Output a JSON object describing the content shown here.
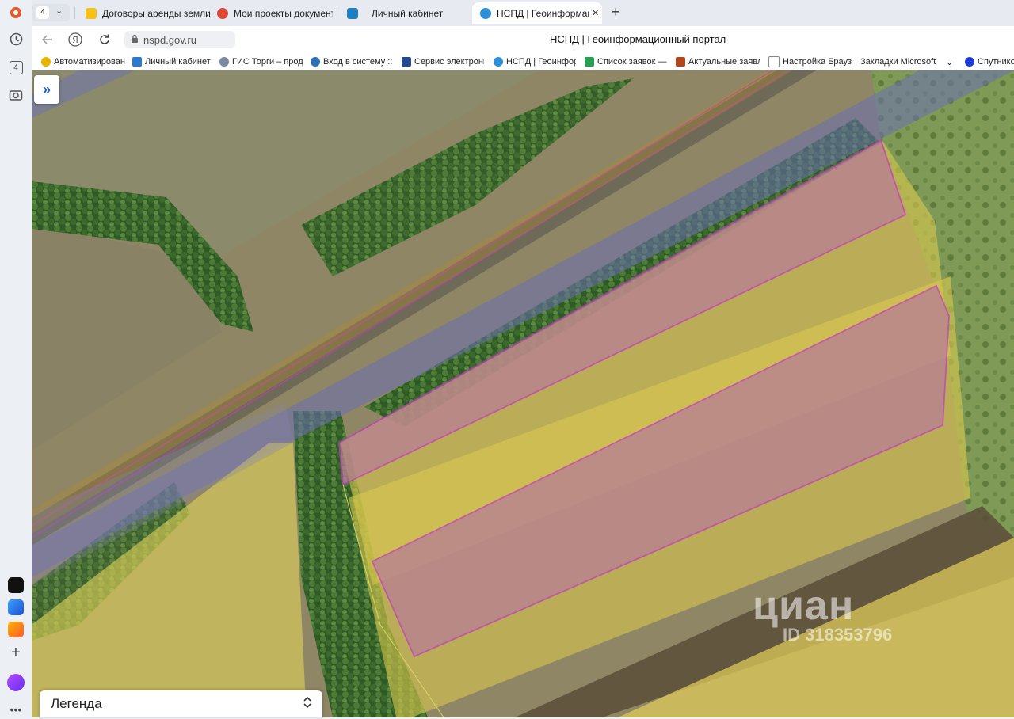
{
  "tabstrip": {
    "tab_count": "4",
    "tabs": [
      {
        "label": "Договоры аренды земли",
        "icon": "smiley-yellow-icon"
      },
      {
        "label": "Мои проекты документо",
        "icon": "gosuslugi-icon"
      },
      {
        "label": "Личный кабинет",
        "icon": "cabinet-icon"
      },
      {
        "label": "НСПД | Геоинформаци",
        "icon": "nspd-icon",
        "active": true
      }
    ],
    "close_glyph": "✕",
    "new_tab_glyph": "+"
  },
  "addressbar": {
    "url": "nspd.gov.ru",
    "page_title": "НСПД | Геоинформационный портал"
  },
  "bookmarks": [
    {
      "label": "Автоматизирован",
      "color": "#e9b400"
    },
    {
      "label": "Личный кабинет",
      "color": "#2d78d0"
    },
    {
      "label": "ГИС Торги – прод",
      "color": "#7a8aa0"
    },
    {
      "label": "Вход в систему ::",
      "color": "#2f6fb3"
    },
    {
      "label": "Сервис электронн",
      "color": "#234a8c"
    },
    {
      "label": "НСПД | Геоинфор",
      "color": "#2d8fd6"
    },
    {
      "label": "Список заявок —",
      "color": "#2a9d52"
    },
    {
      "label": "Актуальные заявл",
      "color": "#b4461e"
    },
    {
      "label": "Настройка Браузе",
      "color": "#888888"
    },
    {
      "label": "Закладки Microsoft",
      "color": "#ffffff"
    },
    {
      "label": "Спутнико",
      "color": "#1d3bd6"
    }
  ],
  "bookmarks_more_glyph": "⌄",
  "sidebar": {
    "tab_badge": "4"
  },
  "map": {
    "expand_glyph": "»",
    "legend_label": "Легенда",
    "legend_toggle_glyph": "⌃⌄",
    "watermark_brand": "циан",
    "watermark_id": "ID 318353796"
  },
  "colors": {
    "parcel_outline": "#c23bbf",
    "yellow_overlay": "#e2d35a",
    "pink_overlay": "#b77d95",
    "road_overlay": "#6b6fb5"
  }
}
